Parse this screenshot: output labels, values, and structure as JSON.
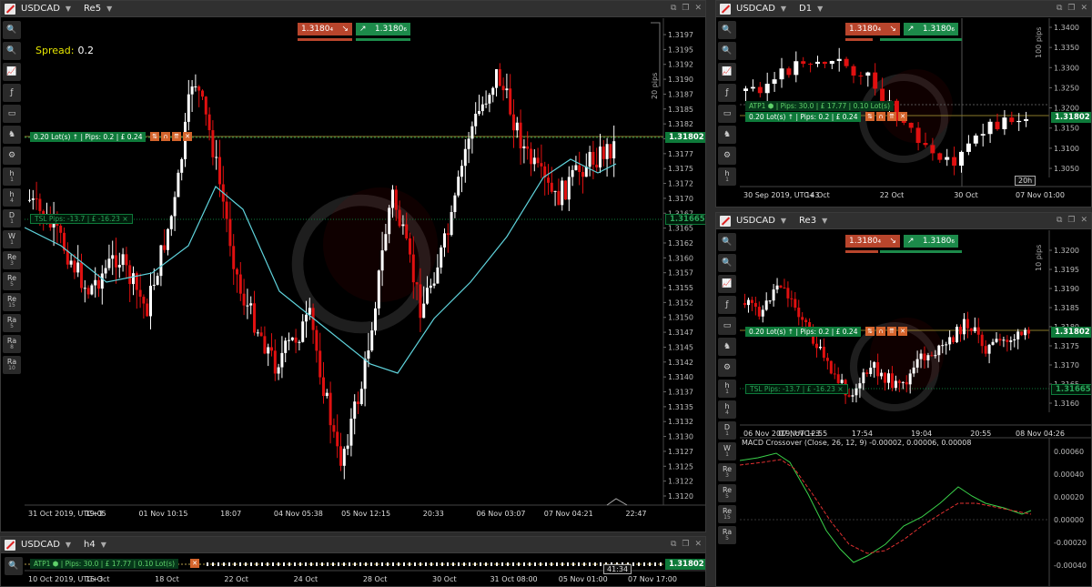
{
  "colors": {
    "bull": "#ffffff",
    "bear": "#e01010",
    "ma": "#5fd3dc",
    "macd": "#3ad14a",
    "signal": "#e03030"
  },
  "main": {
    "symbol": "USDCAD",
    "timeframe": "Re5",
    "bid": "1.3180₄",
    "ask": "1.3180₆",
    "spread_label": "Spread:",
    "spread_value": "0.2",
    "pips_label": "20 pips",
    "position": "0.20 Lot(s) ↑ | Pips: 0.2 | £ 0.24",
    "tsl": "TSL   Pips: -13.7 | £ -16.23 ×",
    "price_tag": "1.31802",
    "tsl_tag": "1.31665",
    "price_ticks": [
      "1.3197",
      "1.3195",
      "1.3192",
      "1.3190",
      "1.3187",
      "1.3185",
      "1.3182",
      "1.3180",
      "1.3177",
      "1.3175",
      "1.3172",
      "1.3170",
      "1.3167",
      "1.3165",
      "1.3162",
      "1.3160",
      "1.3157",
      "1.3155",
      "1.3152",
      "1.3150",
      "1.3147",
      "1.3145",
      "1.3142",
      "1.3140",
      "1.3137",
      "1.3135",
      "1.3132",
      "1.3130",
      "1.3127",
      "1.3125",
      "1.3122",
      "1.3120"
    ],
    "time_ticks": [
      "31 Oct 2019, UTC+3",
      "19:05",
      "01 Nov 10:15",
      "18:07",
      "04 Nov 05:38",
      "05 Nov 12:15",
      "20:33",
      "06 Nov 03:07",
      "07 Nov 04:21",
      "22:47"
    ],
    "toolbar": [
      "🔍",
      "🔍",
      "📈",
      "ƒ",
      "▭",
      "♞",
      "⚙",
      "h\n1",
      "h\n4",
      "D\n1",
      "W\n1",
      "Re\n3",
      "Re\n5",
      "Re\n15",
      "Ra\n5",
      "Ra\n8",
      "Ra\n10"
    ]
  },
  "h4": {
    "symbol": "USDCAD",
    "timeframe": "h4",
    "position": "ATP1 ⬢ | Pips: 30.0 | £ 17.77 | 0.10 Lot(s)",
    "price_tag": "1.31802",
    "time_tag": "41:34",
    "time_ticks": [
      "10 Oct 2019, UTC+3",
      "16 Oct",
      "18 Oct",
      "22 Oct",
      "24 Oct",
      "28 Oct",
      "30 Oct",
      "31 Oct 08:00",
      "05 Nov 01:00",
      "07 Nov 17:00"
    ]
  },
  "d1": {
    "symbol": "USDCAD",
    "timeframe": "D1",
    "bid": "1.3180₄",
    "ask": "1.3180₆",
    "pips_label": "100 pips",
    "atp": "ATP1 ⬢ | Pips: 30.0 | £ 17.77 | 0.10 Lot(s)",
    "position": "0.20 Lot(s) ↑ | Pips: 0.2 | £ 0.24",
    "price_tag": "1.31802",
    "price_ticks": [
      "1.3400",
      "1.3350",
      "1.3300",
      "1.3250",
      "1.3200",
      "1.3150",
      "1.3100",
      "1.3050"
    ],
    "time_ticks": [
      "30 Sep 2019, UTC+3",
      "14 Oct",
      "22 Oct",
      "30 Oct",
      "07 Nov 01:00"
    ],
    "time_tag": "20h"
  },
  "re3": {
    "symbol": "USDCAD",
    "timeframe": "Re3",
    "bid": "1.3180₄",
    "ask": "1.3180₆",
    "pips_label": "10 pips",
    "position": "0.20 Lot(s) ↑ | Pips: 0.2 | £ 0.24",
    "tsl": "TSL   Pips: -13.7 | £ -16.23 ×",
    "price_tag": "1.31802",
    "tsl_tag": "1.31665",
    "price_ticks": [
      "1.3200",
      "1.3195",
      "1.3190",
      "1.3185",
      "1.3180",
      "1.3175",
      "1.3170",
      "1.3165",
      "1.3160"
    ],
    "time_ticks": [
      "06 Nov 2019, UTC+3",
      "07 Nov 12:55",
      "17:54",
      "19:04",
      "20:55",
      "08 Nov 04:26"
    ],
    "macd_label": "MACD Crossover (Close, 26, 12, 9) -0.00002, 0.00006, 0.00008",
    "macd_ticks": [
      "0.00060",
      "0.00040",
      "0.00020",
      "0.00000",
      "-0.00020",
      "-0.00040"
    ]
  }
}
